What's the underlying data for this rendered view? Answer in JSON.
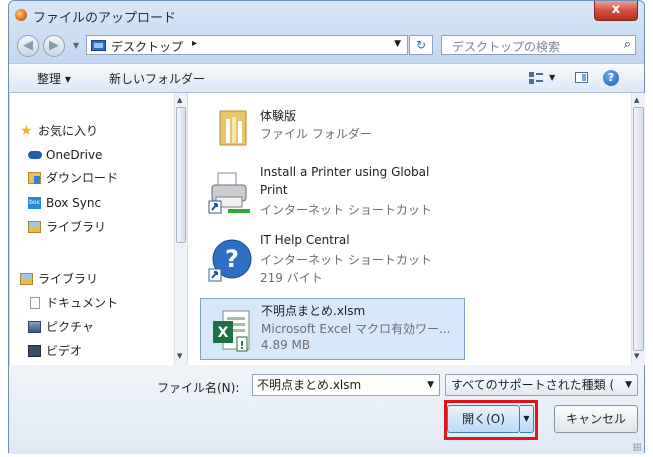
{
  "window": {
    "title": "ファイルのアップロード",
    "close_label": "x"
  },
  "navigation": {
    "address": "デスクトップ",
    "address_separator": "▸",
    "search_placeholder": "デスクトップの検索"
  },
  "toolbar": {
    "organize_label": "整理 ▾",
    "new_folder_label": "新しいフォルダー",
    "help_label": "?"
  },
  "sidebar": {
    "items": [
      {
        "label": "お気に入り",
        "icon": "star-icon",
        "color": "#f0b21e"
      },
      {
        "label": "OneDrive",
        "icon": "cloud-icon",
        "color": "#1e5db3"
      },
      {
        "label": "ダウンロード",
        "icon": "download-folder-icon",
        "color": "#3b8de0"
      },
      {
        "label": "Box Sync",
        "icon": "box-icon",
        "color": "#2a89d6"
      },
      {
        "label": "ライブラリ",
        "icon": "library-icon",
        "color": "#d9b44a"
      },
      {
        "label": "ライブラリ",
        "icon": "library-icon",
        "color": "#d9b44a"
      },
      {
        "label": "ドキュメント",
        "icon": "document-icon",
        "color": "#8aa0b7"
      },
      {
        "label": "ピクチャ",
        "icon": "picture-icon",
        "color": "#4f6f96"
      },
      {
        "label": "ビデオ",
        "icon": "video-icon",
        "color": "#3a4c66"
      }
    ]
  },
  "files": [
    {
      "name": "体験版",
      "type": "ファイル フォルダー",
      "icon": "folder-icon"
    },
    {
      "name": "Install a Printer using Global",
      "name2": "Print",
      "type": "インターネット ショートカット",
      "icon": "printer-shortcut-icon"
    },
    {
      "name": "IT Help Central",
      "type": "インターネット ショートカット",
      "size": "219 バイト",
      "icon": "help-shortcut-icon"
    },
    {
      "name": "不明点まとめ.xlsm",
      "type": "Microsoft Excel マクロ有効ワー...",
      "size": "4.89 MB",
      "icon": "excel-icon",
      "selected": true
    }
  ],
  "footer": {
    "filename_label": "ファイル名(N):",
    "filename_value": "不明点まとめ.xlsm",
    "filetype_value": "すべてのサポートされた種類 (",
    "open_label": "開く(O)",
    "cancel_label": "キャンセル"
  },
  "colors": {
    "highlight": "#e0141a",
    "selection": "#d8e8fb",
    "excel": "#1e7145"
  }
}
